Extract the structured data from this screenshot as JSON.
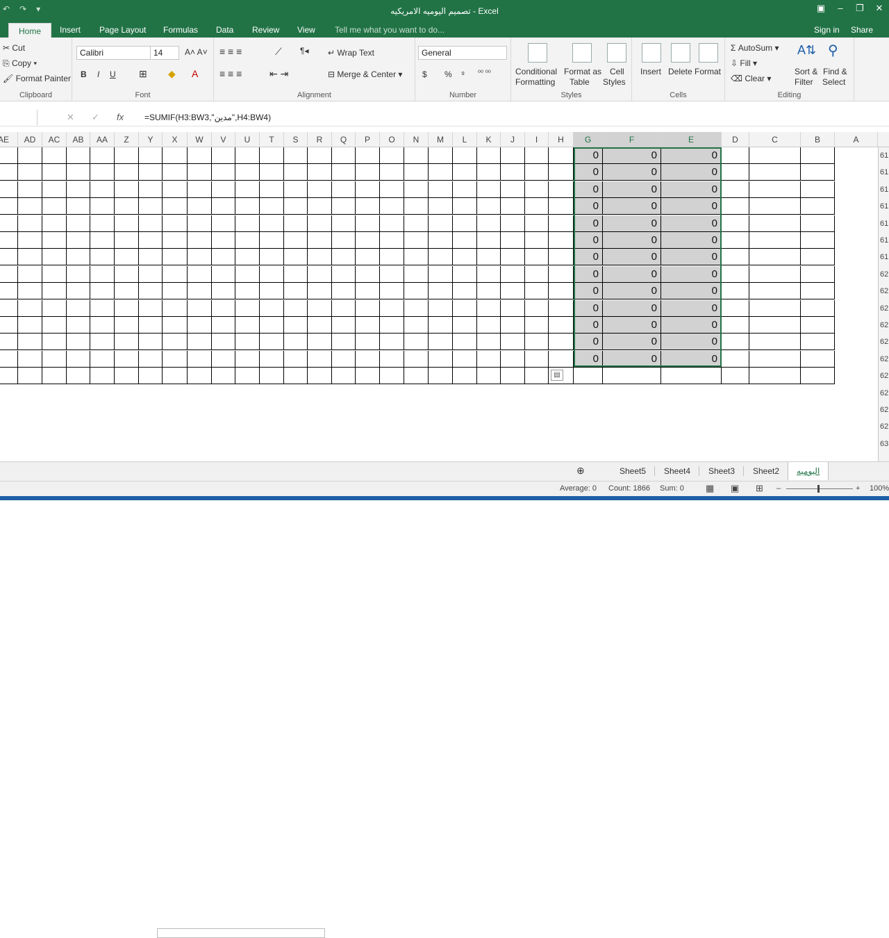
{
  "window": {
    "title": "تصميم اليوميه الامريكيه - Excel",
    "controls": [
      "restore-ribbon-icon",
      "minimize-icon",
      "maximize-icon",
      "close-icon"
    ]
  },
  "tabs": [
    "Home",
    "Insert",
    "Page Layout",
    "Formulas",
    "Data",
    "Review",
    "View"
  ],
  "active_tab": "Home",
  "tell_me": "Tell me what you want to do...",
  "account": {
    "sign_in": "Sign in",
    "share": "Share"
  },
  "ribbon": {
    "clipboard": {
      "label": "Clipboard",
      "cut": "Cut",
      "copy": "Copy",
      "format_painter": "Format Painter"
    },
    "font": {
      "label": "Font",
      "name": "Calibri",
      "size": "14",
      "bold": "B",
      "italic": "I",
      "underline": "U"
    },
    "alignment": {
      "label": "Alignment",
      "wrap_text": "Wrap Text",
      "merge_center": "Merge & Center"
    },
    "number": {
      "label": "Number",
      "format": "General",
      "currency": "$",
      "percent": "%",
      "comma": "⁹"
    },
    "styles": {
      "label": "Styles",
      "conditional_1": "Conditional",
      "conditional_2": "Formatting",
      "format_table_1": "Format as",
      "format_table_2": "Table",
      "cell_styles_1": "Cell",
      "cell_styles_2": "Styles"
    },
    "cells": {
      "label": "Cells",
      "insert": "Insert",
      "delete": "Delete",
      "format": "Format"
    },
    "editing": {
      "label": "Editing",
      "autosum": "AutoSum",
      "fill": "Fill",
      "clear": "Clear",
      "sort_1": "Sort &",
      "sort_2": "Filter",
      "find_1": "Find &",
      "find_2": "Select"
    }
  },
  "formula_bar": {
    "fx": "fx",
    "formula": "=SUMIF(H3:BW3,\"مدين\",H4:BW4)"
  },
  "columns": [
    "AE",
    "AD",
    "AC",
    "AB",
    "AA",
    "Z",
    "Y",
    "X",
    "W",
    "V",
    "U",
    "T",
    "S",
    "R",
    "Q",
    "P",
    "O",
    "N",
    "M",
    "L",
    "K",
    "J",
    "I",
    "H",
    "G",
    "F",
    "E",
    "D",
    "C",
    "B",
    "A"
  ],
  "rows": [
    {
      "header": "61",
      "g": "0",
      "f": "0",
      "e": "0"
    },
    {
      "header": "61",
      "g": "0",
      "f": "0",
      "e": "0"
    },
    {
      "header": "61",
      "g": "0",
      "f": "0",
      "e": "0"
    },
    {
      "header": "61",
      "g": "0",
      "f": "0",
      "e": "0"
    },
    {
      "header": "61",
      "g": "0",
      "f": "0",
      "e": "0"
    },
    {
      "header": "61",
      "g": "0",
      "f": "0",
      "e": "0"
    },
    {
      "header": "61",
      "g": "0",
      "f": "0",
      "e": "0"
    },
    {
      "header": "62",
      "g": "0",
      "f": "0",
      "e": "0"
    },
    {
      "header": "62",
      "g": "0",
      "f": "0",
      "e": "0"
    },
    {
      "header": "62",
      "g": "0",
      "f": "0",
      "e": "0"
    },
    {
      "header": "62",
      "g": "0",
      "f": "0",
      "e": "0"
    },
    {
      "header": "62",
      "g": "0",
      "f": "0",
      "e": "0"
    },
    {
      "header": "62",
      "g": "0",
      "f": "0",
      "e": "0"
    },
    {
      "header": "62",
      "g": "",
      "f": "",
      "e": ""
    },
    {
      "header": "62",
      "g": "",
      "f": "",
      "e": ""
    },
    {
      "header": "62",
      "g": "",
      "f": "",
      "e": ""
    },
    {
      "header": "62",
      "g": "",
      "f": "",
      "e": ""
    },
    {
      "header": "63",
      "g": "",
      "f": "",
      "e": ""
    }
  ],
  "sheets": [
    "Sheet5",
    "Sheet4",
    "Sheet3",
    "Sheet2",
    "اليوميه"
  ],
  "active_sheet": "اليوميه",
  "status": {
    "average": "Average: 0",
    "count": "Count: 1866",
    "sum": "Sum: 0",
    "zoom": "100%"
  },
  "colors": {
    "brand": "#217346",
    "selection": "#d2d2d2"
  }
}
